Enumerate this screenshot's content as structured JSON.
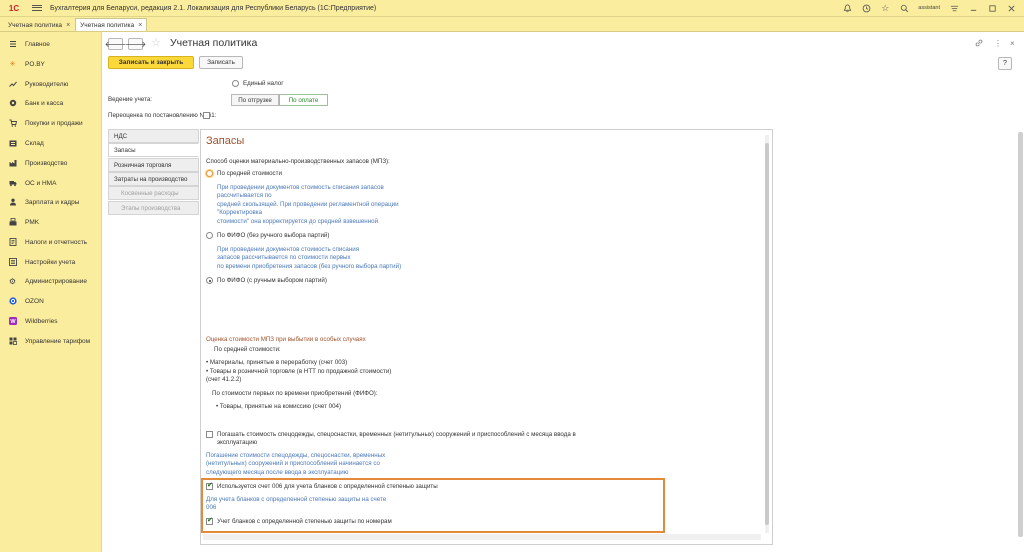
{
  "window": {
    "logo": "1С",
    "title": "Бухгалтерия для Беларуси, редакция 2.1. Локализация для Республики Беларусь  (1С:Предприятие)",
    "user": "assistant"
  },
  "tabs": [
    {
      "label": "Учетная политика",
      "active": false
    },
    {
      "label": "Учетная политика",
      "active": true
    }
  ],
  "sidebar": {
    "items": [
      {
        "label": "Главное",
        "icon": "menu-icon"
      },
      {
        "label": "PO.BY",
        "icon": "sun-icon"
      },
      {
        "label": "Руководителю",
        "icon": "chart-icon"
      },
      {
        "label": "Банк и касса",
        "icon": "coin-icon"
      },
      {
        "label": "Покупки и продажи",
        "icon": "cart-icon"
      },
      {
        "label": "Склад",
        "icon": "warehouse-icon"
      },
      {
        "label": "Производство",
        "icon": "factory-icon"
      },
      {
        "label": "ОС и НМА",
        "icon": "truck-icon"
      },
      {
        "label": "Зарплата и кадры",
        "icon": "person-icon"
      },
      {
        "label": "PMK",
        "icon": "cash-register-icon"
      },
      {
        "label": "Налоги и отчетность",
        "icon": "tax-icon"
      },
      {
        "label": "Настройки учета",
        "icon": "settings-icon"
      },
      {
        "label": "Администрирование",
        "icon": "gear-icon"
      },
      {
        "label": "OZON",
        "icon": "ozon-icon"
      },
      {
        "label": "Wildberries",
        "icon": "wildberries-icon"
      },
      {
        "label": "Управление тарифом",
        "icon": "tariff-icon"
      }
    ]
  },
  "page": {
    "title": "Учетная политика",
    "save_close_label": "Записать и закрыть",
    "save_label": "Записать",
    "help_label": "?"
  },
  "top_fields": {
    "single_tax_label": "Единый налог",
    "accounting_label": "Ведение учета:",
    "seg_shipment": "По отгрузке",
    "seg_payment": "По оплате",
    "revaluation_label": "Переоценка по постановлению № 61:"
  },
  "vtabs": [
    {
      "label": "НДС",
      "active": false,
      "sub": false
    },
    {
      "label": "Запасы",
      "active": true,
      "sub": false
    },
    {
      "label": "Розничная торговля",
      "active": false,
      "sub": false
    },
    {
      "label": "Затраты на производство",
      "active": false,
      "sub": false
    },
    {
      "label": "Косвенные расходы",
      "active": false,
      "sub": true
    },
    {
      "label": "Этапы производства",
      "active": false,
      "sub": true
    }
  ],
  "inventory": {
    "title": "Запасы",
    "method_label": "Способ оценки материально-производственных запасов (МПЗ):",
    "opt_average": "По средней стоимости",
    "avg_hint_1": "При проведении документов стоимость списания запасов",
    "avg_hint_2": "рассчитывается по",
    "avg_hint_3": "средней скользящей. При проведении регламентной операции",
    "avg_hint_4": "\"Корректировка",
    "avg_hint_5": "стоимости\" она корректируется до средней взвешенной",
    "opt_fifo_auto": "По ФИФО (без ручного выбора партий)",
    "fifo_hint_1": "При проведении документов стоимость списания",
    "fifo_hint_2": "запасов рассчитывается по стоимости первых",
    "fifo_hint_3": "по времени приобретения запасов (без ручного выбора партий)",
    "opt_fifo_manual": "По ФИФО (с ручным выбором партий)",
    "special_title": "Оценка стоимости МПЗ при выбытии в  особых случаях",
    "special_avg": "По средней стоимости:",
    "special_avg_1": "• Материалы, принятые в переработку (счет 003)",
    "special_avg_2": "• Товары в розничной торговле (в НТТ по продажной стоимости)",
    "special_avg_3": "(счет 41.2.2)",
    "special_fifo": "По стоимости первых по времени приобретений (ФИФО):",
    "special_fifo_1": "• Товары, принятые на комиссию (счет 004)",
    "workwear_label_1": "Погашать стоимость спецодежды, спецоснастки,  временных (нетитульных) сооружений и приспособлений с месяца ввода в",
    "workwear_label_2": "эксплуатацию",
    "workwear_hint_1": "Погашение стоимости спецодежды, спецоснастки, временных",
    "workwear_hint_2": "(нетитульных) сооружений и приспособлений начинается со",
    "workwear_hint_3": "следующего месяца после ввода в эксплуатацию",
    "acct006_label": "Используется счет 006 для учета бланков с определенной степенью защиты",
    "acct006_hint_1": "Для учета бланков с определенной степенью защиты на счете",
    "acct006_hint_2": "006",
    "forms_by_number_label": "Учет бланков с определенной степенью защиты по номерам"
  },
  "colors": {
    "chrome": "#fbed9e",
    "primary_button": "#fbd83a",
    "section_title": "#a0522d",
    "hint_text": "#4a78b8",
    "highlight_border": "#e38b3a"
  }
}
